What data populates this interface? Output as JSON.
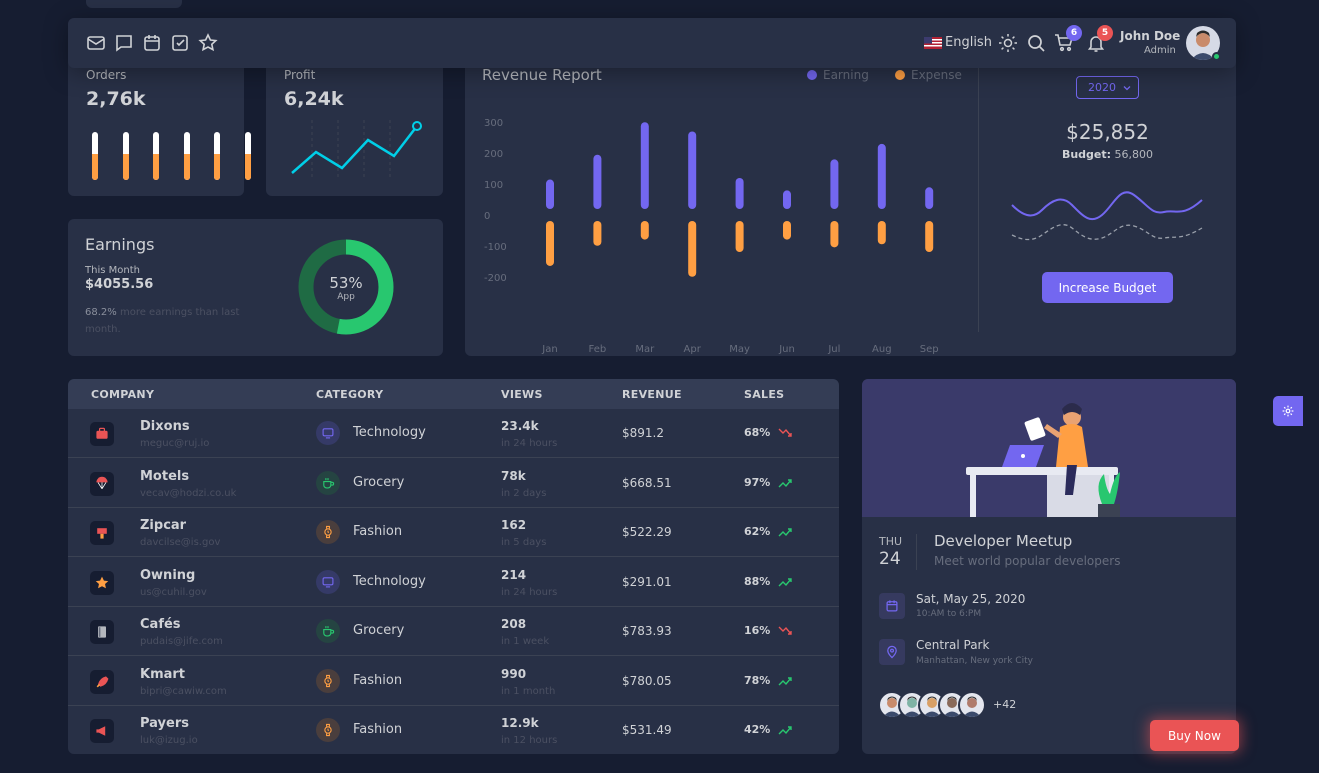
{
  "navbar": {
    "language": "English",
    "cart_count": "6",
    "notification_count": "5",
    "user_name": "John Doe",
    "user_role": "Admin",
    "icons": [
      "email-icon",
      "chat-icon",
      "calendar-icon",
      "checkbox-icon",
      "star-icon",
      "flag-icon",
      "sun-icon",
      "search-icon",
      "cart-icon",
      "bell-icon"
    ]
  },
  "orders": {
    "label": "Orders",
    "value": "2,76k",
    "bar_levels": [
      0.55,
      0.55,
      0.55,
      0.55,
      0.55,
      0.55
    ]
  },
  "profit": {
    "label": "Profit",
    "value": "6,24k"
  },
  "earnings": {
    "title": "Earnings",
    "month_label": "This Month",
    "amount": "$4055.56",
    "note_pct": "68.2%",
    "note_text": "more earnings than last month.",
    "donut_pct": "53%",
    "donut_label": "App",
    "donut_fraction": 0.53
  },
  "revenue_report": {
    "title": "Revenue Report",
    "legend_earning": "Earning",
    "legend_expense": "Expense",
    "year_select": "2020",
    "total": "$25,852",
    "budget_label": "Budget:",
    "budget_value": "56,800",
    "button": "Increase Budget"
  },
  "chart_data": {
    "type": "bar",
    "categories": [
      "Jan",
      "Feb",
      "Mar",
      "Apr",
      "May",
      "Jun",
      "Jul",
      "Aug",
      "Sep"
    ],
    "series": [
      {
        "name": "Earning",
        "values": [
          95,
          175,
          280,
          250,
          100,
          60,
          160,
          210,
          70
        ]
      },
      {
        "name": "Expense",
        "values": [
          -145,
          -80,
          -60,
          -180,
          -100,
          -60,
          -85,
          -75,
          -100
        ]
      }
    ],
    "y_ticks": [
      "300",
      "200",
      "100",
      "0",
      "-100",
      "-200"
    ],
    "ylim": [
      -200,
      300
    ],
    "colors": {
      "Earning": "#7367f0",
      "Expense": "#ff9f43"
    }
  },
  "table": {
    "headers": [
      "COMPANY",
      "CATEGORY",
      "VIEWS",
      "REVENUE",
      "SALES"
    ],
    "rows": [
      {
        "company": "Dixons",
        "email": "meguc@ruj.io",
        "category": "Technology",
        "views": "23.4k",
        "views_sub": "in 24 hours",
        "revenue": "$891.2",
        "sales": "68%",
        "trend": "down"
      },
      {
        "company": "Motels",
        "email": "vecav@hodzi.co.uk",
        "category": "Grocery",
        "views": "78k",
        "views_sub": "in 2 days",
        "revenue": "$668.51",
        "sales": "97%",
        "trend": "up"
      },
      {
        "company": "Zipcar",
        "email": "davcilse@is.gov",
        "category": "Fashion",
        "views": "162",
        "views_sub": "in 5 days",
        "revenue": "$522.29",
        "sales": "62%",
        "trend": "up"
      },
      {
        "company": "Owning",
        "email": "us@cuhil.gov",
        "category": "Technology",
        "views": "214",
        "views_sub": "in 24 hours",
        "revenue": "$291.01",
        "sales": "88%",
        "trend": "up"
      },
      {
        "company": "Cafés",
        "email": "pudais@jife.com",
        "category": "Grocery",
        "views": "208",
        "views_sub": "in 1 week",
        "revenue": "$783.93",
        "sales": "16%",
        "trend": "down"
      },
      {
        "company": "Kmart",
        "email": "bipri@cawiw.com",
        "category": "Fashion",
        "views": "990",
        "views_sub": "in 1 month",
        "revenue": "$780.05",
        "sales": "78%",
        "trend": "up"
      },
      {
        "company": "Payers",
        "email": "luk@izug.io",
        "category": "Fashion",
        "views": "12.9k",
        "views_sub": "in 12 hours",
        "revenue": "$531.49",
        "sales": "42%",
        "trend": "up"
      }
    ]
  },
  "meetup": {
    "day": "THU",
    "date": "24",
    "title": "Developer Meetup",
    "subtitle": "Meet world popular developers",
    "when": "Sat, May 25, 2020",
    "time": "10:AM to 6:PM",
    "where": "Central Park",
    "address": "Manhattan, New york City",
    "more_count": "+42"
  },
  "buy_now": "Buy Now",
  "colors": {
    "bg": "#161d31",
    "card": "#283046",
    "primary": "#7367f0",
    "warning": "#ff9f43",
    "success": "#28c76f",
    "danger": "#ea5455",
    "info": "#00cfe8"
  }
}
